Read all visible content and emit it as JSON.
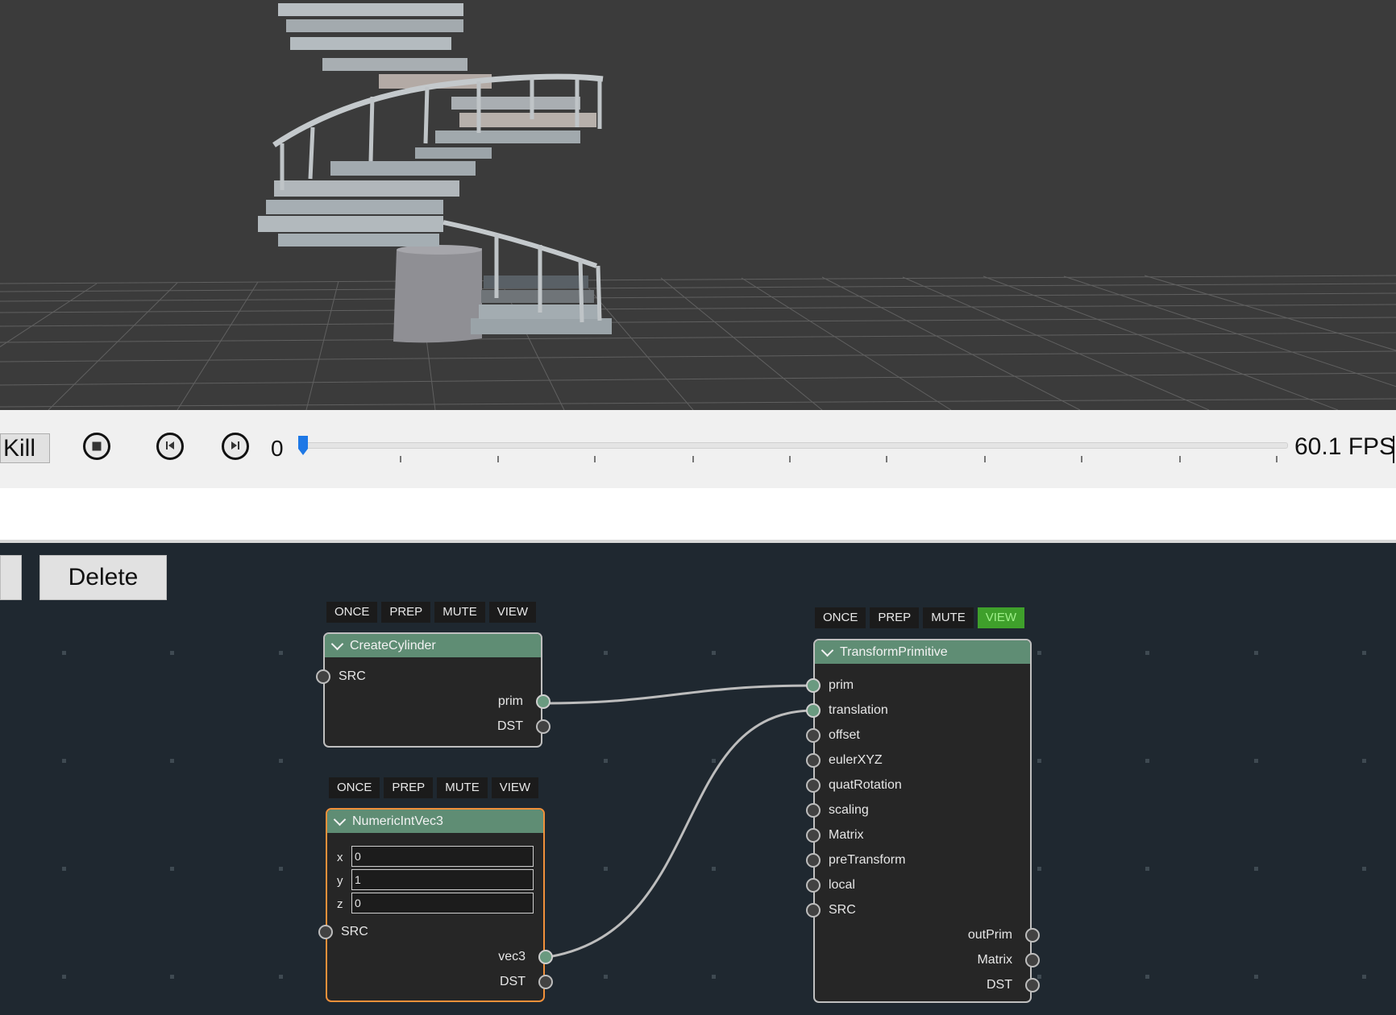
{
  "timeline": {
    "kill_label": "Kill",
    "stop_icon": "stop-icon",
    "prev_icon": "step-back-icon",
    "next_icon": "step-forward-icon",
    "current_frame": "0",
    "fps": "60.1 FPS",
    "slider_position": 0,
    "accent_color": "#1e78e6"
  },
  "toolbar": {
    "delete_label": "Delete"
  },
  "nodes": {
    "create_cylinder": {
      "title": "CreateCylinder",
      "modes": [
        "ONCE",
        "PREP",
        "MUTE",
        "VIEW"
      ],
      "inputs": [
        "SRC"
      ],
      "outputs": [
        "prim",
        "DST"
      ]
    },
    "numeric_int_vec3": {
      "title": "NumericIntVec3",
      "modes": [
        "ONCE",
        "PREP",
        "MUTE",
        "VIEW"
      ],
      "fields": [
        {
          "label": "x",
          "value": "0"
        },
        {
          "label": "y",
          "value": "1"
        },
        {
          "label": "z",
          "value": "0"
        }
      ],
      "inputs": [
        "SRC"
      ],
      "outputs": [
        "vec3",
        "DST"
      ]
    },
    "transform_primitive": {
      "title": "TransformPrimitive",
      "modes": [
        "ONCE",
        "PREP",
        "MUTE",
        "VIEW"
      ],
      "active_mode": "VIEW",
      "inputs": [
        "prim",
        "translation",
        "offset",
        "eulerXYZ",
        "quatRotation",
        "scaling",
        "Matrix",
        "preTransform",
        "local",
        "SRC"
      ],
      "outputs": [
        "outPrim",
        "Matrix",
        "DST"
      ]
    }
  },
  "colors": {
    "viewport_bg": "#3b3b3b",
    "editor_bg": "#1f2830",
    "node_header": "#5f8d74",
    "selected_border": "#f0903a",
    "view_active": "#3fa02b"
  }
}
